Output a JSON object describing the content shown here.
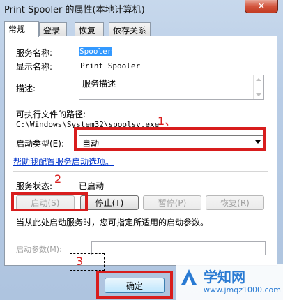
{
  "window": {
    "title": "Print Spooler 的属性(本地计算机)",
    "close_label": "✕"
  },
  "tabs": [
    {
      "label": "常规",
      "active": true
    },
    {
      "label": "登录"
    },
    {
      "label": "恢复"
    },
    {
      "label": "依存关系"
    }
  ],
  "general": {
    "service_name_label": "服务名称:",
    "service_name_value": "Spooler",
    "display_name_label": "显示名称:",
    "display_name_value": "Print Spooler",
    "description_label": "描述:",
    "description_value": "服务描述",
    "exe_path_label": "可执行文件的路径:",
    "exe_path_value": "C:\\Windows\\System32\\spoolsv.exe",
    "startup_type_label": "启动类型(E):",
    "startup_type_value": "自动",
    "help_link": "帮助我配置服务启动选项。",
    "status_label": "服务状态:",
    "status_value": "已启动",
    "start_button": "启动(S)",
    "stop_button": "停止(T)",
    "pause_button": "暂停(P)",
    "resume_button": "恢复(R)",
    "start_hint": "当从此处启动服务时，您可指定所适用的启动参数。",
    "start_params_label": "启动参数(M):",
    "start_params_value": ""
  },
  "annotations": {
    "step1": "1、",
    "step2": "2",
    "step3": "3"
  },
  "footer": {
    "ok_button": "确定"
  },
  "watermark": {
    "title": "学知网",
    "url": "www.jmqz1000.com"
  }
}
